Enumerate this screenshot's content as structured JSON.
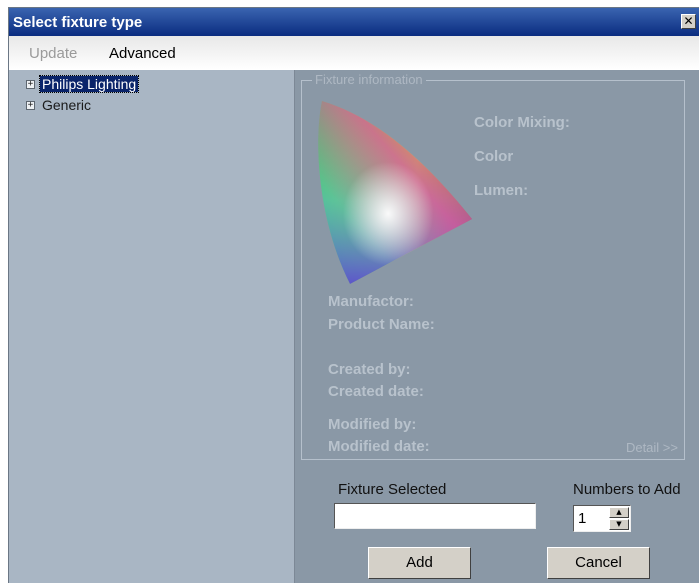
{
  "window": {
    "title": "Select fixture type",
    "close_glyph": "✕"
  },
  "menu": {
    "update": "Update",
    "advanced": "Advanced"
  },
  "tree": {
    "items": [
      {
        "label": "Philips Lighting",
        "expander": "+",
        "selected": true
      },
      {
        "label": "Generic",
        "expander": "+",
        "selected": false
      }
    ]
  },
  "fixture_info": {
    "legend": "Fixture information",
    "color_mixing": "Color Mixing:",
    "color": "Color",
    "lumen": "Lumen:",
    "manufactor": "Manufactor:",
    "product_name": "Product Name:",
    "created_by": "Created by:",
    "created_date": "Created date:",
    "modified_by": "Modified by:",
    "modified_date": "Modified date:",
    "detail_link": "Detail >>"
  },
  "form": {
    "fixture_selected_label": "Fixture Selected",
    "fixture_selected_value": "",
    "numbers_to_add_label": "Numbers to Add",
    "numbers_to_add_value": "1",
    "add_button": "Add",
    "cancel_button": "Cancel"
  },
  "icons": {
    "close": "close-icon",
    "expand": "plus-icon",
    "gamut": "color-gamut-icon",
    "spin_up": "up-arrow-icon",
    "spin_down": "down-arrow-icon"
  },
  "colors": {
    "titlebar": "#0a2c80",
    "panel_bg": "#a9b6c4",
    "info_bg": "#8a98a6",
    "selection": "#0a246a"
  }
}
